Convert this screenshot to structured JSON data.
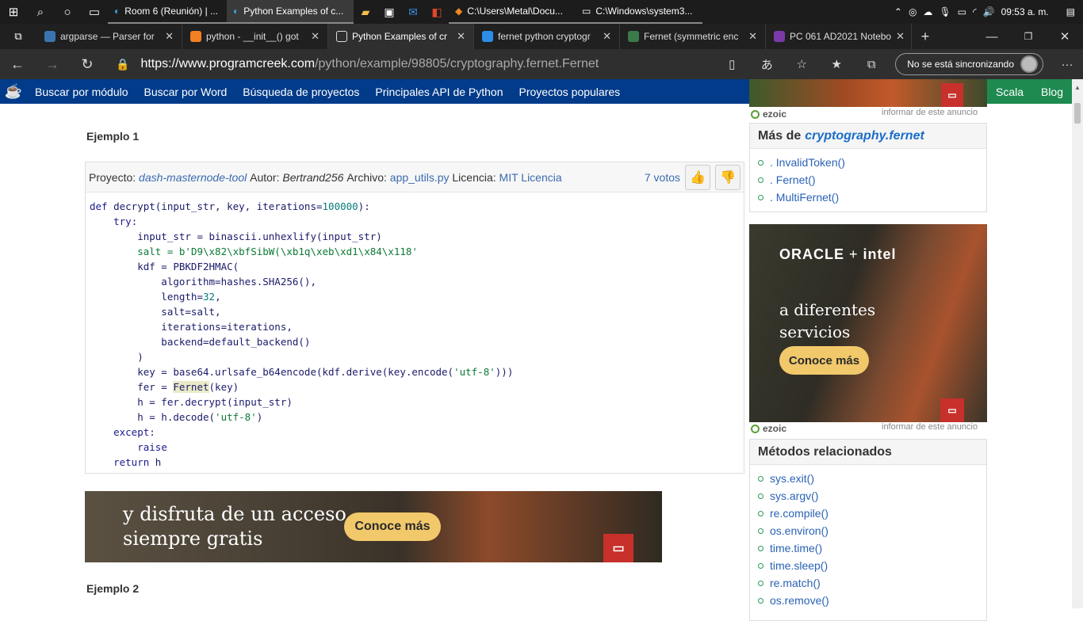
{
  "taskbar": {
    "apps": [
      {
        "label": "Room 6 (Reunión) | ...",
        "icon": "edge-icon",
        "active": false
      },
      {
        "label": "Python Examples of c...",
        "icon": "edge-icon",
        "active": true
      },
      {
        "label": "C:\\Users\\Metal\\Docu...",
        "icon": "sublime-icon",
        "active": false
      },
      {
        "label": "C:\\Windows\\system3...",
        "icon": "cmd-icon",
        "active": false
      }
    ],
    "time": "09:53 a. m."
  },
  "tabs": [
    {
      "label": "argparse — Parser for",
      "active": false
    },
    {
      "label": "python - __init__() got",
      "active": false
    },
    {
      "label": "Python Examples of cr",
      "active": true
    },
    {
      "label": "fernet python cryptogr",
      "active": false
    },
    {
      "label": "Fernet (symmetric enc",
      "active": false
    },
    {
      "label": "PC 061 AD2021 Notebo",
      "active": false
    }
  ],
  "address": {
    "scheme": "https://",
    "host": "www.programcreek.com",
    "path": "/python/example/98805/cryptography.fernet.Fernet",
    "sync_label": "No se está sincronizando"
  },
  "sitenav": {
    "items": [
      "Buscar por módulo",
      "Buscar por Word",
      "Búsqueda de proyectos",
      "Principales API de Python",
      "Proyectos populares"
    ],
    "right_items": [
      "Scala",
      "Blog"
    ]
  },
  "example1": {
    "title": "Ejemplo 1",
    "project_label": "Proyecto:",
    "project": "dash-masternode-tool",
    "author_label": "Autor:",
    "author": "Bertrand256",
    "file_label": "Archivo:",
    "file": "app_utils.py",
    "license_label": "Licencia:",
    "license": "MIT Licencia",
    "votes": "7 votos"
  },
  "code_lines": [
    "def decrypt(input_str, key, iterations=100000):",
    "    try:",
    "        input_str = binascii.unhexlify(input_str)",
    "        salt = b'D9\\x82\\xbfSibW(\\xb1q\\xeb\\xd1\\x84\\x118'",
    "        kdf = PBKDF2HMAC(",
    "            algorithm=hashes.SHA256(),",
    "            length=32,",
    "            salt=salt,",
    "            iterations=iterations,",
    "            backend=default_backend()",
    "        )",
    "        key = base64.urlsafe_b64encode(kdf.derive(key.encode('utf-8')))",
    "        fer = Fernet(key)",
    "        h = fer.decrypt(input_str)",
    "        h = h.decode('utf-8')",
    "    except:",
    "        raise",
    "    return h"
  ],
  "banner": {
    "line1": "y disfruta de un acceso",
    "line2": "siempre gratis",
    "cta": "Conoce más"
  },
  "example2": {
    "title": "Ejemplo 2"
  },
  "sidebar": {
    "ezoic_label": "ezoic",
    "report_label": "informar de este anuncio",
    "more_title": "Más de",
    "more_pkg": "cryptography.fernet",
    "more_items": [
      ". InvalidToken()",
      ". Fernet()",
      ". MultiFernet()"
    ],
    "oracle_ad": {
      "brand1": "ORACLE",
      "plus": "+",
      "brand2": "intel",
      "line1": "a diferentes",
      "line2": "servicios",
      "cta": "Conoce más"
    },
    "related_title": "Métodos relacionados",
    "related_items": [
      "sys.exit()",
      "sys.argv()",
      "re.compile()",
      "os.environ()",
      "time.time()",
      "time.sleep()",
      "re.match()",
      "os.remove()"
    ]
  }
}
